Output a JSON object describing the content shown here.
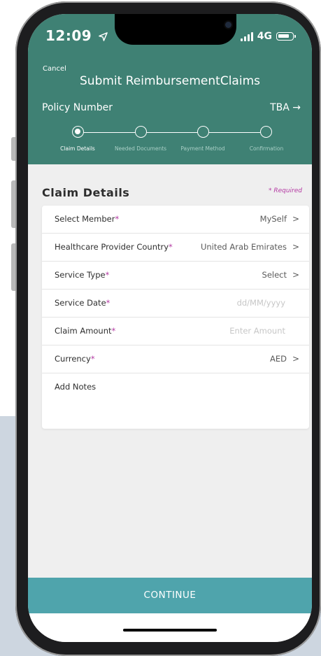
{
  "status_bar": {
    "time": "12:09",
    "location_icon": "location-arrow-icon",
    "network": "4G"
  },
  "header": {
    "cancel_label": "Cancel",
    "title": "Submit ReimbursementClaims",
    "policy_label": "Policy Number",
    "policy_value": "TBA",
    "policy_arrow": "→"
  },
  "steps": [
    {
      "label": "Claim Details",
      "active": true
    },
    {
      "label": "Needed Documents",
      "active": false
    },
    {
      "label": "Payment Method",
      "active": false
    },
    {
      "label": "Confirmation",
      "active": false
    }
  ],
  "section": {
    "title": "Claim Details",
    "required_note": "* Required"
  },
  "form": {
    "rows": [
      {
        "label": "Select Member",
        "required": "*",
        "value": "MySelf",
        "chevron": ">"
      },
      {
        "label": "Healthcare Provider Country",
        "required": "*",
        "value": "United Arab Emirates",
        "chevron": ">"
      },
      {
        "label": "Service Type",
        "required": "*",
        "value": "Select",
        "chevron": ">"
      },
      {
        "label": "Service Date",
        "required": "*",
        "placeholder": "dd/MM/yyyy"
      },
      {
        "label": "Claim Amount",
        "required": "*",
        "placeholder": "Enter Amount"
      },
      {
        "label": "Currency",
        "required": "*",
        "value": "AED",
        "chevron": ">"
      },
      {
        "label": "Add Notes"
      }
    ]
  },
  "footer": {
    "continue_label": "CONTINUE"
  },
  "colors": {
    "header": "#3f8174",
    "accent": "#4fa4ac",
    "required": "#b43aa3"
  }
}
